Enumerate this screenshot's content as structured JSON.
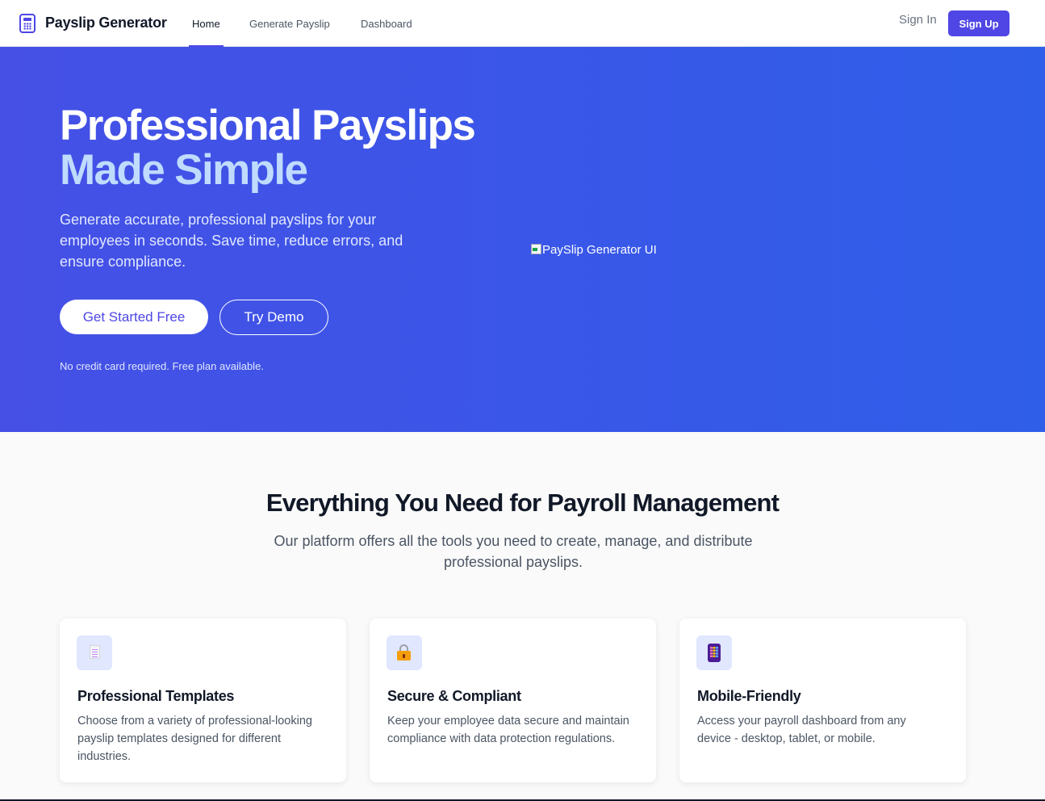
{
  "nav": {
    "brand": "Payslip Generator",
    "links": [
      {
        "label": "Home",
        "active": true
      },
      {
        "label": "Generate Payslip",
        "active": false
      },
      {
        "label": "Dashboard",
        "active": false
      }
    ],
    "sign_in": "Sign In",
    "sign_up": "Sign Up",
    "logo_icon": "calculator-icon"
  },
  "hero": {
    "title_line1": "Professional Payslips",
    "title_line2": "Made Simple",
    "subtitle": "Generate accurate, professional payslips for your employees in seconds. Save time, reduce errors, and ensure compliance.",
    "cta_primary": "Get Started Free",
    "cta_secondary": "Try Demo",
    "note": "No credit card required. Free plan available.",
    "image_alt": "PaySlip Generator UI"
  },
  "features": {
    "title": "Everything You Need for Payroll Management",
    "subtitle": "Our platform offers all the tools you need to create, manage, and distribute professional payslips.",
    "cards": [
      {
        "icon": "document-icon",
        "title": "Professional Templates",
        "description": "Choose from a variety of professional-looking payslip templates designed for different industries."
      },
      {
        "icon": "lock-icon",
        "title": "Secure & Compliant",
        "description": "Keep your employee data secure and maintain compliance with data protection regulations."
      },
      {
        "icon": "mobile-phone-icon",
        "title": "Mobile-Friendly",
        "description": "Access your payroll dashboard from any device - desktop, tablet, or mobile."
      }
    ]
  },
  "colors": {
    "primary": "#4f46e5",
    "hero_gradient_start": "#4650e5",
    "hero_gradient_end": "#2f5fe9",
    "title_accent": "#bfdbfe"
  }
}
